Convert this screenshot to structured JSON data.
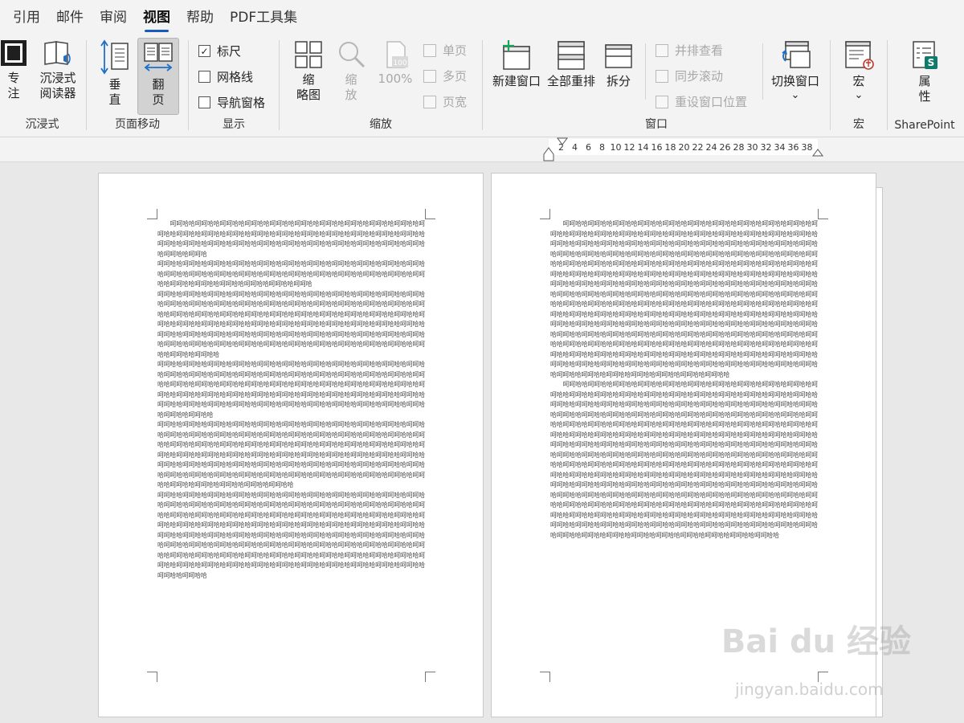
{
  "tabs": [
    "引用",
    "邮件",
    "审阅",
    "视图",
    "帮助",
    "PDF工具集"
  ],
  "active_tab": "视图",
  "ribbon": {
    "groups": {
      "immersive": "沉浸式",
      "page_move": "页面移动",
      "show": "显示",
      "zoom": "缩放",
      "window": "窗口",
      "macro": "宏",
      "sharepoint": "SharePoint"
    },
    "focus_label_1": "专",
    "focus_label_2": "注",
    "reader_label_1": "沉浸式",
    "reader_label_2": "阅读器",
    "vertical_label_1": "垂",
    "vertical_label_2": "直",
    "flip_label_1": "翻",
    "flip_label_2": "页",
    "ruler_label": "标尺",
    "ruler_checked": true,
    "gridlines_label": "网格线",
    "gridlines_checked": false,
    "navpane_label": "导航窗格",
    "navpane_checked": false,
    "thumb_label_1": "缩",
    "thumb_label_2": "略图",
    "zoom_label_1": "缩",
    "zoom_label_2": "放",
    "zoom100_label": "100%",
    "one_page": "单页",
    "multi_page": "多页",
    "page_width": "页宽",
    "new_window": "新建窗口",
    "arrange_all": "全部重排",
    "split": "拆分",
    "side_by_side": "并排查看",
    "sync_scroll": "同步滚动",
    "reset_window": "重设窗口位置",
    "switch_window": "切换窗口",
    "macro": "宏",
    "props_label_1": "属",
    "props_label_2": "性",
    "chevron": "⌄"
  },
  "ruler_ticks": [
    "2",
    "4",
    "6",
    "8",
    "10",
    "12",
    "14",
    "16",
    "18",
    "20",
    "22",
    "24",
    "26",
    "28",
    "30",
    "32",
    "34",
    "36",
    "38"
  ],
  "page1_paragraphs": [
    "呵呵哈哈呵呵哈哈呵呵哈哈呵呵哈哈呵呵哈哈呵呵哈哈呵呵哈哈呵呵哈哈呵呵哈哈呵呵哈哈呵呵哈哈呵呵哈哈呵呵哈哈呵呵哈哈呵呵哈哈呵呵哈哈呵呵哈哈呵呵哈哈呵呵哈哈呵呵哈哈呵呵哈哈呵呵哈哈呵呵哈哈呵呵哈哈呵呵哈哈呵呵哈哈呵呵哈哈呵呵哈哈呵呵哈哈呵呵哈哈呵呵哈哈呵呵哈哈呵呵哈哈呵呵哈",
    "呵呵哈哈呵呵哈哈呵呵哈哈呵呵哈哈呵呵哈哈呵呵哈哈呵呵哈哈呵呵哈哈呵呵哈哈呵呵哈哈呵呵哈哈呵呵哈哈呵呵哈哈呵呵哈哈呵呵哈哈呵呵哈哈呵呵哈哈呵呵哈哈呵呵哈哈呵呵哈哈呵呵哈哈呵呵哈哈呵呵哈哈呵呵哈哈呵呵哈哈呵呵哈哈呵呵哈哈呵呵哈",
    "呵呵哈哈呵呵哈哈呵呵哈哈呵呵哈哈呵呵哈哈呵呵哈哈呵呵哈哈呵呵哈哈呵呵哈哈呵呵哈哈呵呵哈哈呵呵哈哈呵呵哈哈呵呵哈哈呵呵哈哈呵呵哈哈呵呵哈哈呵呵哈哈呵呵哈哈呵呵哈哈呵呵哈哈呵呵哈哈呵呵哈哈呵呵哈哈呵呵哈哈呵呵哈哈呵呵哈哈呵呵哈哈呵呵哈哈呵呵哈哈呵呵哈哈呵呵哈哈呵呵哈哈呵呵哈哈呵呵哈哈呵呵哈哈呵呵哈哈呵呵哈哈呵呵哈哈呵呵哈哈呵呵哈哈呵呵哈哈呵呵哈哈呵呵哈哈呵呵哈哈呵呵哈哈呵呵哈哈呵呵哈哈呵呵哈哈呵呵哈哈呵呵哈哈呵呵哈哈呵呵哈哈呵呵哈哈呵呵哈哈呵呵哈哈呵呵哈哈呵呵哈哈呵呵哈哈呵呵哈哈呵呵哈哈呵呵哈哈呵呵哈哈呵呵哈哈呵呵哈哈呵呵哈哈呵呵哈哈",
    "呵呵哈哈呵呵哈哈呵呵哈哈呵呵哈哈呵呵哈哈呵呵哈哈呵呵哈哈呵呵哈哈呵呵哈哈呵呵哈哈呵呵哈哈呵呵哈哈呵呵哈哈呵呵哈哈呵呵哈哈呵呵哈哈呵呵哈哈呵呵哈哈呵呵哈哈呵呵哈哈呵呵哈哈呵呵哈哈呵呵哈哈呵呵哈哈呵呵哈哈呵呵哈哈呵呵哈哈呵呵哈哈呵呵哈哈呵呵哈哈呵呵哈哈呵呵哈哈呵呵哈哈呵呵哈哈呵呵哈哈呵呵哈哈呵呵哈哈呵呵哈哈呵呵哈哈呵呵哈哈呵呵哈哈呵呵哈哈呵呵哈哈呵呵哈哈呵呵哈哈呵呵哈哈呵呵哈哈呵呵哈哈呵呵哈哈呵呵哈哈呵呵哈哈呵呵哈哈呵呵哈哈呵呵哈哈呵呵哈哈呵呵哈哈",
    "呵呵哈哈呵呵哈哈呵呵哈哈呵呵哈哈呵呵哈哈呵呵哈哈呵呵哈哈呵呵哈哈呵呵哈哈呵呵哈哈呵呵哈哈呵呵哈哈呵呵哈哈呵呵哈哈呵呵哈哈呵呵哈哈呵呵哈哈呵呵哈哈呵呵哈哈呵呵哈哈呵呵哈哈呵呵哈哈呵呵哈哈呵呵哈哈呵呵哈哈呵呵哈哈呵呵哈哈呵呵哈哈呵呵哈哈呵呵哈哈呵呵哈哈呵呵哈哈呵呵哈哈呵呵哈哈呵呵哈哈呵呵哈哈呵呵哈哈呵呵哈哈呵呵哈哈呵呵哈哈呵呵哈哈呵呵哈哈呵呵哈哈呵呵哈哈呵呵哈哈呵呵哈哈呵呵哈哈呵呵哈哈呵呵哈哈呵呵哈哈呵呵哈哈呵呵哈哈呵呵哈哈呵呵哈哈呵呵哈哈呵呵哈哈呵呵哈哈呵呵哈哈呵呵哈哈呵呵哈哈呵呵哈哈呵呵哈哈呵呵哈哈呵呵哈哈呵呵哈哈呵呵哈哈呵呵哈哈呵呵哈哈呵呵哈哈呵呵哈哈",
    "呵呵哈哈呵呵哈哈呵呵哈哈呵呵哈哈呵呵哈哈呵呵哈哈呵呵哈哈呵呵哈哈呵呵哈哈呵呵哈哈呵呵哈哈呵呵哈哈呵呵哈哈呵呵哈哈呵呵哈哈呵呵哈哈呵呵哈哈呵呵哈哈呵呵哈哈呵呵哈哈呵呵哈哈呵呵哈哈呵呵哈哈呵呵哈哈呵呵哈哈呵呵哈哈呵呵哈哈呵呵哈哈呵呵哈哈呵呵哈哈呵呵哈哈呵呵哈哈呵呵哈哈呵呵哈哈呵呵哈哈呵呵哈哈呵呵哈哈呵呵哈哈呵呵哈哈呵呵哈哈呵呵哈哈呵呵哈哈呵呵哈哈呵呵哈哈呵呵哈哈呵呵哈哈呵呵哈哈呵呵哈哈呵呵哈哈呵呵哈哈呵呵哈哈呵呵哈哈呵呵哈哈呵呵哈哈呵呵哈哈呵呵哈哈呵呵哈哈呵呵哈哈呵呵哈哈呵呵哈哈呵呵哈哈呵呵哈哈呵呵哈哈呵呵哈哈呵呵哈哈呵呵哈哈呵呵哈哈呵呵哈哈呵呵哈哈呵呵哈哈呵呵哈哈呵呵哈哈呵呵哈哈呵呵哈哈呵呵哈哈呵呵哈哈呵呵哈哈呵呵哈哈呵呵哈哈呵呵哈哈呵呵哈哈呵呵哈哈呵呵哈哈呵呵哈哈呵呵哈哈呵呵哈哈呵呵哈哈呵呵哈哈"
  ],
  "page2_paragraphs": [
    "呵呵哈哈呵呵哈哈呵呵哈哈呵呵哈哈呵呵哈哈呵呵哈哈呵呵哈哈呵呵哈哈呵呵哈哈呵呵哈哈呵呵哈哈呵呵哈哈呵呵哈哈呵呵哈哈呵呵哈哈呵呵哈哈呵呵哈哈呵呵哈哈呵呵哈哈呵呵哈哈呵呵哈哈呵呵哈哈呵呵哈哈呵呵哈哈呵呵哈哈呵呵哈哈呵呵哈哈呵呵哈哈呵呵哈哈呵呵哈哈呵呵哈哈呵呵哈哈呵呵哈哈呵呵哈哈呵呵哈哈呵呵哈哈呵呵哈哈呵呵哈哈呵呵哈哈呵呵哈哈呵呵哈哈呵呵哈哈呵呵哈哈呵呵哈哈呵呵哈哈呵呵哈哈呵呵哈哈呵呵哈哈呵呵哈哈呵呵哈哈呵呵哈哈呵呵哈哈呵呵哈哈呵呵哈哈呵呵哈哈呵呵哈哈呵呵哈哈呵呵哈哈呵呵哈哈呵呵哈哈呵呵哈哈呵呵哈哈呵呵哈哈呵呵哈哈呵呵哈哈呵呵哈哈呵呵哈哈呵呵哈哈呵呵哈哈呵呵哈哈呵呵哈哈呵呵哈哈呵呵哈哈呵呵哈哈呵呵哈哈呵呵哈哈呵呵哈哈呵呵哈哈呵呵哈哈呵呵哈哈呵呵哈哈呵呵哈哈呵呵哈哈呵呵哈哈呵呵哈哈呵呵哈哈呵呵哈哈呵呵哈哈呵呵哈哈呵呵哈哈呵呵哈哈呵呵哈哈呵呵哈哈呵呵哈哈呵呵哈哈呵呵哈哈呵呵哈哈呵呵哈哈呵呵哈哈呵呵哈哈呵呵哈哈呵呵哈哈呵呵哈哈呵呵哈哈呵呵哈哈呵呵哈哈呵呵哈哈呵呵哈哈呵呵哈哈呵呵哈哈呵呵哈哈呵呵哈哈呵呵哈哈呵呵哈哈呵呵哈哈呵呵哈哈呵呵哈哈呵呵哈哈呵呵哈哈呵呵哈哈呵呵哈哈呵呵哈哈呵呵哈哈呵呵哈哈呵呵哈哈呵呵哈哈呵呵哈哈呵呵哈哈呵呵哈哈呵呵哈哈呵呵哈哈呵呵哈哈呵呵哈哈呵呵哈哈呵呵哈哈呵呵哈哈呵呵哈哈呵呵哈哈呵呵哈哈呵呵哈哈呵呵哈哈呵呵哈哈呵呵哈哈呵呵哈哈呵呵哈哈呵呵哈哈呵呵哈哈呵呵哈哈呵呵哈哈呵呵哈哈呵呵哈哈呵呵哈哈呵呵哈哈呵呵哈哈呵呵哈哈呵呵哈哈呵呵哈哈呵呵哈哈呵呵哈哈呵呵哈哈呵呵哈哈呵呵哈哈呵呵哈哈呵呵哈哈呵呵哈哈呵呵哈哈呵呵哈哈呵呵哈哈",
    "呵呵哈哈呵呵哈哈呵呵哈哈呵呵哈哈呵呵哈哈呵呵哈哈呵呵哈哈呵呵哈哈呵呵哈哈呵呵哈哈呵呵哈哈呵呵哈哈呵呵哈哈呵呵哈哈呵呵哈哈呵呵哈哈呵呵哈哈呵呵哈哈呵呵哈哈呵呵哈哈呵呵哈哈呵呵哈哈呵呵哈哈呵呵哈哈呵呵哈哈呵呵哈哈呵呵哈哈呵呵哈哈呵呵哈哈呵呵哈哈呵呵哈哈呵呵哈哈呵呵哈哈呵呵哈哈呵呵哈哈呵呵哈哈呵呵哈哈呵呵哈哈呵呵哈哈呵呵哈哈呵呵哈哈呵呵哈哈呵呵哈哈呵呵哈哈呵呵哈哈呵呵哈哈呵呵哈哈呵呵哈哈呵呵哈哈呵呵哈哈呵呵哈哈呵呵哈哈呵呵哈哈呵呵哈哈呵呵哈哈呵呵哈哈呵呵哈哈呵呵哈哈呵呵哈哈呵呵哈哈呵呵哈哈呵呵哈哈呵呵哈哈呵呵哈哈呵呵哈哈呵呵哈哈呵呵哈哈呵呵哈哈呵呵哈哈呵呵哈哈呵呵哈哈呵呵哈哈呵呵哈哈呵呵哈哈呵呵哈哈呵呵哈哈呵呵哈哈呵呵哈哈呵呵哈哈呵呵哈哈呵呵哈哈呵呵哈哈呵呵哈哈呵呵哈哈呵呵哈哈呵呵哈哈呵呵哈哈呵呵哈哈呵呵哈哈呵呵哈哈呵呵哈哈呵呵哈哈呵呵哈哈呵呵哈哈呵呵哈哈呵呵哈哈呵呵哈哈呵呵哈哈呵呵哈哈呵呵哈哈呵呵哈哈呵呵哈哈呵呵哈哈呵呵哈哈呵呵哈哈呵呵哈哈呵呵哈哈呵呵哈哈呵呵哈哈呵呵哈哈呵呵哈哈呵呵哈哈呵呵哈哈呵呵哈哈呵呵哈哈呵呵哈哈呵呵哈哈呵呵哈哈呵呵哈哈呵呵哈哈呵呵哈哈呵呵哈哈呵呵哈哈呵呵哈哈呵呵哈哈呵呵哈哈呵呵哈哈呵呵哈哈呵呵哈哈呵呵哈哈呵呵哈哈呵呵哈哈呵呵哈哈呵呵哈哈呵呵哈哈呵呵哈哈呵呵哈哈呵呵哈哈呵呵哈哈呵呵哈哈呵呵哈哈呵呵哈哈呵呵哈哈呵呵哈哈呵呵哈哈呵呵哈哈呵呵哈哈呵呵哈哈呵呵哈哈呵呵哈哈呵呵哈哈呵呵哈哈呵呵哈哈呵呵哈哈呵呵哈哈呵呵哈哈呵呵哈哈呵呵哈哈呵呵哈哈呵呵哈哈呵呵哈哈呵呵哈哈呵呵哈哈呵呵哈哈呵呵哈哈呵呵哈哈呵呵哈哈呵呵哈哈呵呵哈哈呵呵哈哈"
  ],
  "watermark": {
    "main": "Bai du 经验",
    "url": "jingyan.baidu.com"
  },
  "colors": {
    "accent": "#185abd",
    "ribbon_bg": "#f3f3f3",
    "workspace_bg": "#e8e8e8"
  }
}
